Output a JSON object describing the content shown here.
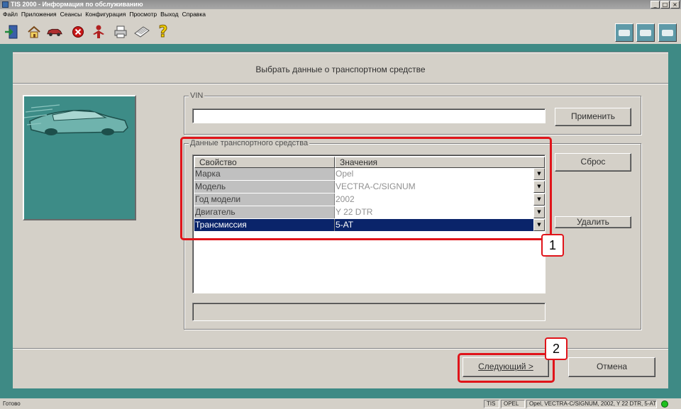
{
  "window": {
    "title": "TIS 2000 - Информация по обслуживанию",
    "minimize": "_",
    "maximize": "□",
    "close": "×"
  },
  "menu": [
    "Файл",
    "Приложения",
    "Сеансы",
    "Конфигурация",
    "Просмотр",
    "Выход",
    "Справка"
  ],
  "toolbar": {
    "left_icons": [
      "exit-door-icon",
      "home-icon",
      "vehicle-icon",
      "stop-icon",
      "person-icon",
      "printer-icon",
      "notebook-icon",
      "help-icon"
    ],
    "help_glyph": "?",
    "right_icons": [
      "diagnostic-tool-icon",
      "vehicle-data-icon",
      "service-vehicle-icon"
    ]
  },
  "panel": {
    "title": "Выбрать данные о транспортном средстве"
  },
  "vin": {
    "label": "VIN",
    "value": "",
    "apply_button": "Применить"
  },
  "vehicle_data": {
    "label": "Данные транспортного средства",
    "headers": [
      "Свойство",
      "Значения"
    ],
    "rows": [
      {
        "property": "Марка",
        "value": "Opel"
      },
      {
        "property": "Модель",
        "value": "VECTRA-C/SIGNUM"
      },
      {
        "property": "Год модели",
        "value": "2002"
      },
      {
        "property": "Двигатель",
        "value": "Y 22 DTR"
      },
      {
        "property": "Трансмиссия",
        "value": "5-AT"
      }
    ],
    "selected_row": 4,
    "dropdown_glyph": "▼",
    "reset_button": "Сброс",
    "delete_button": "Удалить"
  },
  "footer": {
    "next_button": "Следующий >",
    "cancel_button": "Отмена"
  },
  "callouts": [
    "1",
    "2"
  ],
  "status": {
    "ready": "Готово",
    "app": "TIS",
    "make": "OPEL",
    "vehicle": "Opel, VECTRA-C/SIGNUM, 2002, Y 22 DTR, 5-AT"
  },
  "colors": {
    "workspace": "#3e8a85",
    "selection": "#0a246a",
    "highlight": "#e0141a",
    "status_ok": "#1ec01e"
  }
}
